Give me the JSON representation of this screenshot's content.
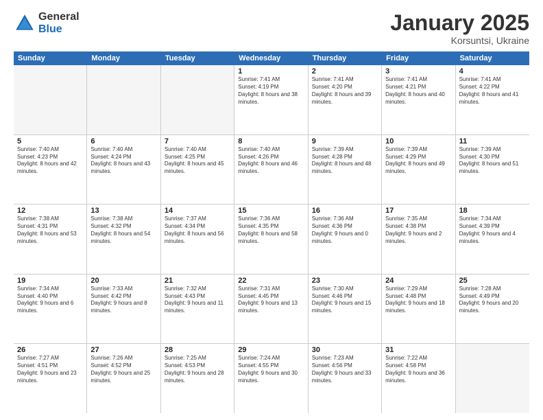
{
  "logo": {
    "general": "General",
    "blue": "Blue"
  },
  "header": {
    "title": "January 2025",
    "subtitle": "Korsuntsi, Ukraine"
  },
  "weekdays": [
    "Sunday",
    "Monday",
    "Tuesday",
    "Wednesday",
    "Thursday",
    "Friday",
    "Saturday"
  ],
  "weeks": [
    [
      {
        "day": "",
        "info": "",
        "empty": true
      },
      {
        "day": "",
        "info": "",
        "empty": true
      },
      {
        "day": "",
        "info": "",
        "empty": true
      },
      {
        "day": "1",
        "info": "Sunrise: 7:41 AM\nSunset: 4:19 PM\nDaylight: 8 hours and 38 minutes.",
        "empty": false
      },
      {
        "day": "2",
        "info": "Sunrise: 7:41 AM\nSunset: 4:20 PM\nDaylight: 8 hours and 39 minutes.",
        "empty": false
      },
      {
        "day": "3",
        "info": "Sunrise: 7:41 AM\nSunset: 4:21 PM\nDaylight: 8 hours and 40 minutes.",
        "empty": false
      },
      {
        "day": "4",
        "info": "Sunrise: 7:41 AM\nSunset: 4:22 PM\nDaylight: 8 hours and 41 minutes.",
        "empty": false
      }
    ],
    [
      {
        "day": "5",
        "info": "Sunrise: 7:40 AM\nSunset: 4:23 PM\nDaylight: 8 hours and 42 minutes.",
        "empty": false
      },
      {
        "day": "6",
        "info": "Sunrise: 7:40 AM\nSunset: 4:24 PM\nDaylight: 8 hours and 43 minutes.",
        "empty": false
      },
      {
        "day": "7",
        "info": "Sunrise: 7:40 AM\nSunset: 4:25 PM\nDaylight: 8 hours and 45 minutes.",
        "empty": false
      },
      {
        "day": "8",
        "info": "Sunrise: 7:40 AM\nSunset: 4:26 PM\nDaylight: 8 hours and 46 minutes.",
        "empty": false
      },
      {
        "day": "9",
        "info": "Sunrise: 7:39 AM\nSunset: 4:28 PM\nDaylight: 8 hours and 48 minutes.",
        "empty": false
      },
      {
        "day": "10",
        "info": "Sunrise: 7:39 AM\nSunset: 4:29 PM\nDaylight: 8 hours and 49 minutes.",
        "empty": false
      },
      {
        "day": "11",
        "info": "Sunrise: 7:39 AM\nSunset: 4:30 PM\nDaylight: 8 hours and 51 minutes.",
        "empty": false
      }
    ],
    [
      {
        "day": "12",
        "info": "Sunrise: 7:38 AM\nSunset: 4:31 PM\nDaylight: 8 hours and 53 minutes.",
        "empty": false
      },
      {
        "day": "13",
        "info": "Sunrise: 7:38 AM\nSunset: 4:32 PM\nDaylight: 8 hours and 54 minutes.",
        "empty": false
      },
      {
        "day": "14",
        "info": "Sunrise: 7:37 AM\nSunset: 4:34 PM\nDaylight: 8 hours and 56 minutes.",
        "empty": false
      },
      {
        "day": "15",
        "info": "Sunrise: 7:36 AM\nSunset: 4:35 PM\nDaylight: 8 hours and 58 minutes.",
        "empty": false
      },
      {
        "day": "16",
        "info": "Sunrise: 7:36 AM\nSunset: 4:36 PM\nDaylight: 9 hours and 0 minutes.",
        "empty": false
      },
      {
        "day": "17",
        "info": "Sunrise: 7:35 AM\nSunset: 4:38 PM\nDaylight: 9 hours and 2 minutes.",
        "empty": false
      },
      {
        "day": "18",
        "info": "Sunrise: 7:34 AM\nSunset: 4:39 PM\nDaylight: 9 hours and 4 minutes.",
        "empty": false
      }
    ],
    [
      {
        "day": "19",
        "info": "Sunrise: 7:34 AM\nSunset: 4:40 PM\nDaylight: 9 hours and 6 minutes.",
        "empty": false
      },
      {
        "day": "20",
        "info": "Sunrise: 7:33 AM\nSunset: 4:42 PM\nDaylight: 9 hours and 8 minutes.",
        "empty": false
      },
      {
        "day": "21",
        "info": "Sunrise: 7:32 AM\nSunset: 4:43 PM\nDaylight: 9 hours and 11 minutes.",
        "empty": false
      },
      {
        "day": "22",
        "info": "Sunrise: 7:31 AM\nSunset: 4:45 PM\nDaylight: 9 hours and 13 minutes.",
        "empty": false
      },
      {
        "day": "23",
        "info": "Sunrise: 7:30 AM\nSunset: 4:46 PM\nDaylight: 9 hours and 15 minutes.",
        "empty": false
      },
      {
        "day": "24",
        "info": "Sunrise: 7:29 AM\nSunset: 4:48 PM\nDaylight: 9 hours and 18 minutes.",
        "empty": false
      },
      {
        "day": "25",
        "info": "Sunrise: 7:28 AM\nSunset: 4:49 PM\nDaylight: 9 hours and 20 minutes.",
        "empty": false
      }
    ],
    [
      {
        "day": "26",
        "info": "Sunrise: 7:27 AM\nSunset: 4:51 PM\nDaylight: 9 hours and 23 minutes.",
        "empty": false
      },
      {
        "day": "27",
        "info": "Sunrise: 7:26 AM\nSunset: 4:52 PM\nDaylight: 9 hours and 25 minutes.",
        "empty": false
      },
      {
        "day": "28",
        "info": "Sunrise: 7:25 AM\nSunset: 4:53 PM\nDaylight: 9 hours and 28 minutes.",
        "empty": false
      },
      {
        "day": "29",
        "info": "Sunrise: 7:24 AM\nSunset: 4:55 PM\nDaylight: 9 hours and 30 minutes.",
        "empty": false
      },
      {
        "day": "30",
        "info": "Sunrise: 7:23 AM\nSunset: 4:56 PM\nDaylight: 9 hours and 33 minutes.",
        "empty": false
      },
      {
        "day": "31",
        "info": "Sunrise: 7:22 AM\nSunset: 4:58 PM\nDaylight: 9 hours and 36 minutes.",
        "empty": false
      },
      {
        "day": "",
        "info": "",
        "empty": true
      }
    ]
  ]
}
